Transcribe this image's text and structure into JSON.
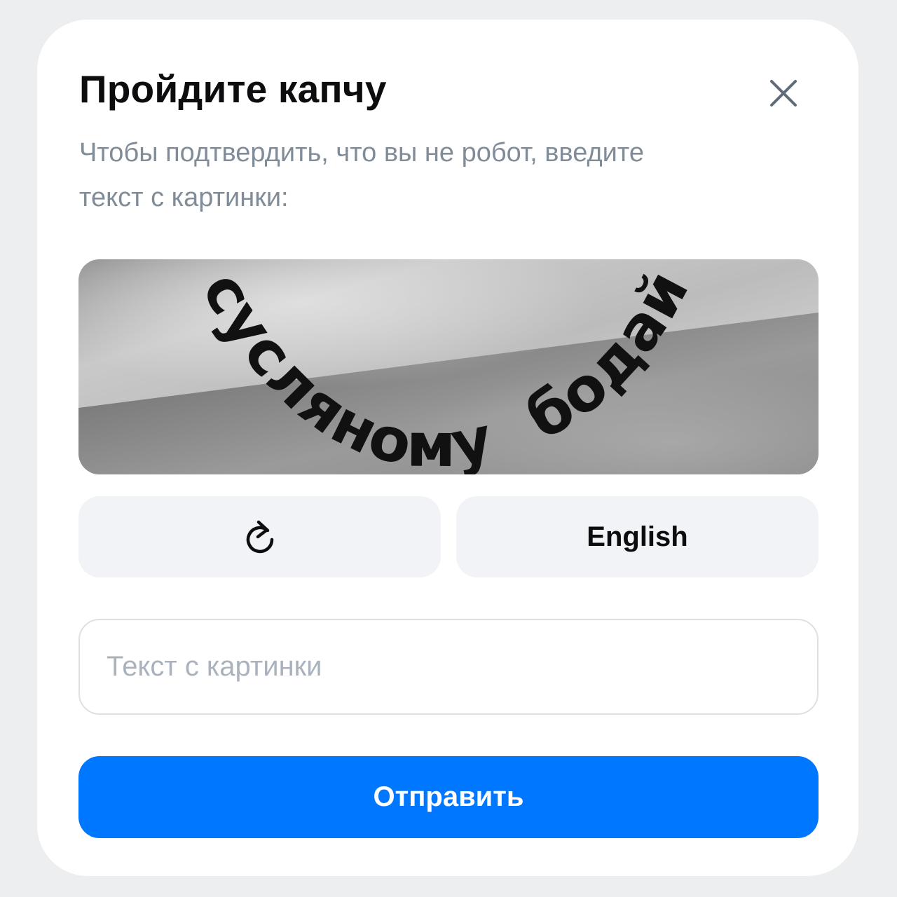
{
  "dialog": {
    "title": "Пройдите капчу",
    "subtitle": "Чтобы подтвердить, что вы не робот, введите текст с картинки:",
    "close_icon": "close-icon"
  },
  "captcha": {
    "words": [
      "суcляному",
      "бодай"
    ]
  },
  "actions": {
    "refresh_icon": "refresh-icon",
    "language_label": "English",
    "submit_label": "Отправить"
  },
  "input": {
    "placeholder": "Текст с картинки",
    "value": ""
  },
  "colors": {
    "accent": "#0077ff",
    "secondary_bg": "#f2f3f7",
    "muted_text": "#818c99"
  }
}
